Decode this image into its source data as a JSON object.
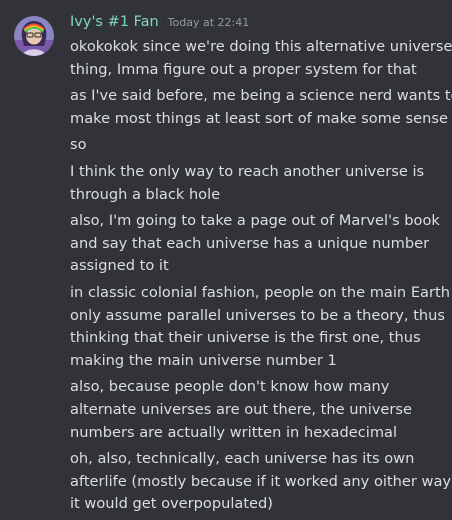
{
  "header": {
    "username": "Ivy's #1 Fan",
    "timestamp": "Today at 22:41"
  },
  "colors": {
    "background": "#313338",
    "username": "#7fd8c0",
    "text": "#dbdee1",
    "timestamp": "#949ba4"
  },
  "messages": [
    {
      "lines": [
        "okokokok since we're doing this alternative universe",
        "thing, Imma figure out a proper system for that"
      ]
    },
    {
      "lines": [
        "as I've said before, me being a science nerd wants to",
        "make most things at least sort of make some sense"
      ]
    },
    {
      "lines": [
        "so"
      ]
    },
    {
      "lines": [
        "I think the only way to reach another universe is",
        "through a black hole"
      ]
    },
    {
      "lines": [
        "also, I'm going to take a page out of Marvel's book",
        "and say that each universe has a unique number",
        "assigned to it"
      ]
    },
    {
      "lines": [
        "in classic colonial fashion, people on the main Earth",
        "only assume parallel universes to be a theory, thus",
        "thinking that their universe is the first one, thus",
        "making the main universe number 1"
      ]
    },
    {
      "lines": [
        "also, because people don't know how many",
        "alternate universes are out there, the universe",
        "numbers are actually written in hexadecimal"
      ]
    },
    {
      "lines": [
        "oh, also, technically, each universe has its own",
        "afterlife (mostly because if it worked any oither way,",
        "it would get overpopulated)"
      ]
    }
  ]
}
